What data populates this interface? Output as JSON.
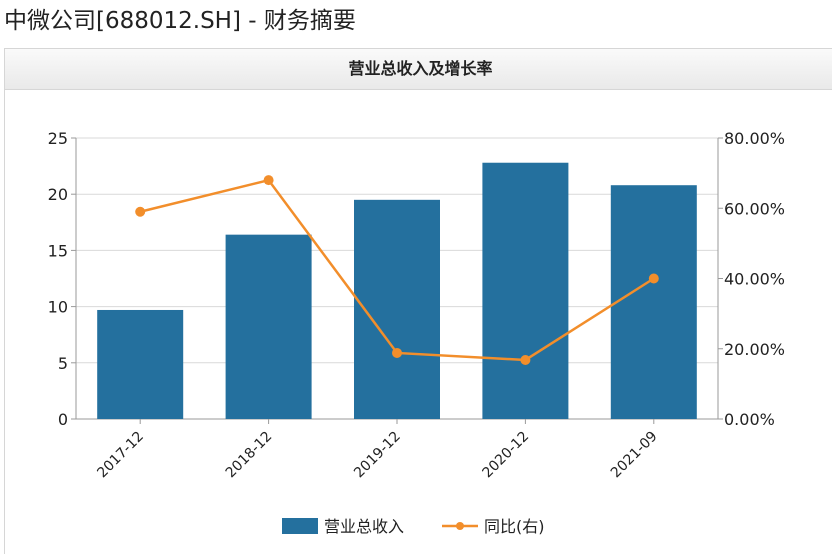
{
  "page": {
    "title": "中微公司[688012.SH] - 财务摘要"
  },
  "chart_data": {
    "type": "bar",
    "title": "营业总收入及增长率",
    "categories": [
      "2017-12",
      "2018-12",
      "2019-12",
      "2020-12",
      "2021-09"
    ],
    "series": [
      {
        "name": "营业总收入",
        "type": "bar",
        "axis": "left",
        "color": "#24709e",
        "values": [
          9.7,
          16.4,
          19.5,
          22.8,
          20.8
        ]
      },
      {
        "name": "同比(右)",
        "type": "line",
        "axis": "right",
        "color": "#f28e2b",
        "values": [
          59.0,
          68.0,
          18.8,
          16.8,
          40.0
        ]
      }
    ],
    "y_left": {
      "min": 0,
      "max": 25,
      "ticks": [
        "0",
        "5",
        "10",
        "15",
        "20",
        "25"
      ],
      "tick_values": [
        0,
        5,
        10,
        15,
        20,
        25
      ]
    },
    "y_right": {
      "min": 0,
      "max": 80,
      "ticks": [
        "0.00%",
        "20.00%",
        "40.00%",
        "60.00%",
        "80.00%"
      ],
      "tick_values": [
        0,
        20,
        40,
        60,
        80
      ]
    },
    "grid": true,
    "legend_position": "bottom-center"
  }
}
